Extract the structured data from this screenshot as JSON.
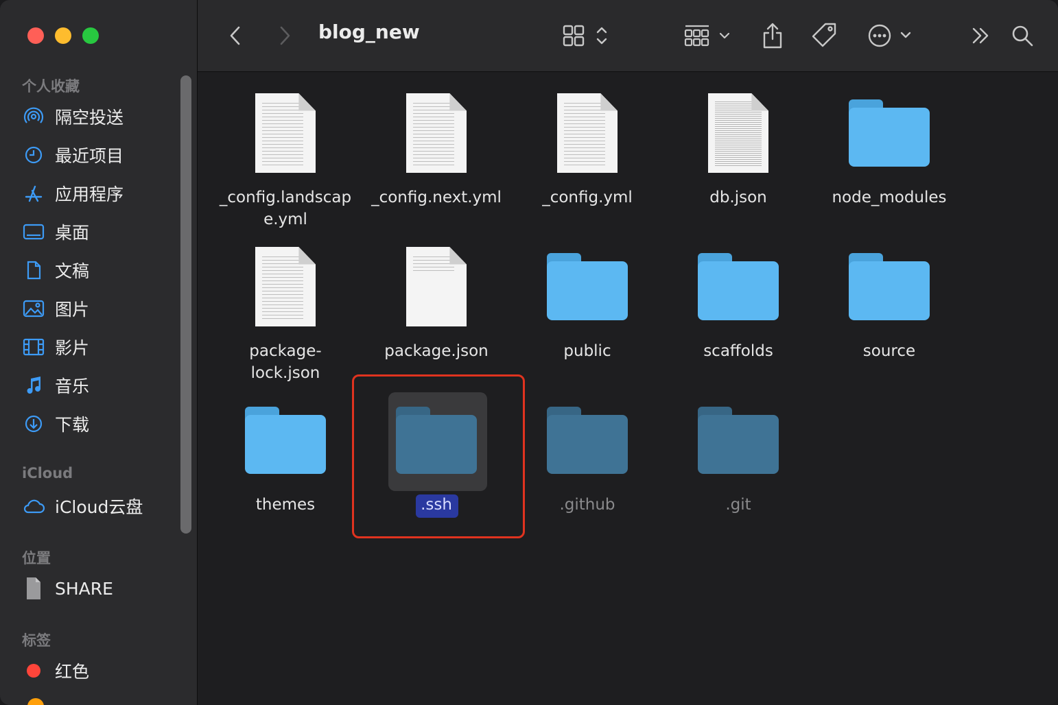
{
  "window": {
    "title": "blog_new"
  },
  "sidebar": {
    "sections": [
      {
        "label": "个人收藏",
        "items": [
          {
            "label": "隔空投送",
            "icon": "airdrop-icon"
          },
          {
            "label": "最近项目",
            "icon": "clock-icon"
          },
          {
            "label": "应用程序",
            "icon": "apps-icon"
          },
          {
            "label": "桌面",
            "icon": "desktop-icon"
          },
          {
            "label": "文稿",
            "icon": "document-icon"
          },
          {
            "label": "图片",
            "icon": "photo-icon"
          },
          {
            "label": "影片",
            "icon": "film-icon"
          },
          {
            "label": "音乐",
            "icon": "music-icon"
          },
          {
            "label": "下载",
            "icon": "download-icon"
          }
        ]
      },
      {
        "label": "iCloud",
        "items": [
          {
            "label": "iCloud云盘",
            "icon": "cloud-icon"
          }
        ]
      },
      {
        "label": "位置",
        "items": [
          {
            "label": "SHARE",
            "icon": "share-drive-icon"
          }
        ]
      },
      {
        "label": "标签",
        "items": [
          {
            "label": "红色",
            "icon": "tag-dot-icon",
            "color": "#ff453a"
          }
        ]
      }
    ]
  },
  "files": [
    {
      "name": "_config.landscape.yml",
      "line1": "_config.landscap",
      "line2": "e.yml",
      "kind": "doc"
    },
    {
      "name": "_config.next.yml",
      "line1": "_config.next.yml",
      "line2": "",
      "kind": "doc"
    },
    {
      "name": "_config.yml",
      "line1": "_config.yml",
      "line2": "",
      "kind": "doc"
    },
    {
      "name": "db.json",
      "line1": "db.json",
      "line2": "",
      "kind": "doc-dense"
    },
    {
      "name": "node_modules",
      "line1": "node_modules",
      "line2": "",
      "kind": "folder"
    },
    {
      "name": "package-lock.json",
      "line1": "package-",
      "line2": "lock.json",
      "kind": "doc"
    },
    {
      "name": "package.json",
      "line1": "package.json",
      "line2": "",
      "kind": "doc-sparse"
    },
    {
      "name": "public",
      "line1": "public",
      "line2": "",
      "kind": "folder"
    },
    {
      "name": "scaffolds",
      "line1": "scaffolds",
      "line2": "",
      "kind": "folder"
    },
    {
      "name": "source",
      "line1": "source",
      "line2": "",
      "kind": "folder"
    },
    {
      "name": "themes",
      "line1": "themes",
      "line2": "",
      "kind": "folder"
    },
    {
      "name": ".ssh",
      "line1": ".ssh",
      "line2": "",
      "kind": "folder-hidden",
      "selected": true
    },
    {
      "name": ".github",
      "line1": ".github",
      "line2": "",
      "kind": "folder-hidden"
    },
    {
      "name": ".git",
      "line1": ".git",
      "line2": "",
      "kind": "folder-hidden"
    }
  ],
  "colors": {
    "folder": "#5cb8f2",
    "folder_tab": "#4aa3dc",
    "folder_hidden": "#3f7395",
    "folder_hidden_tab": "#376685",
    "accent_highlight": "#e0331f",
    "selection_label": "#2a39a0",
    "traffic_red": "#ff5f57",
    "traffic_yellow": "#febc2e",
    "traffic_green": "#28c840",
    "sidebar_icon": "#3d9bf6"
  },
  "toolbar": {
    "icons": [
      "back-icon",
      "forward-icon",
      "grid-view-icon",
      "group-icon",
      "share-icon",
      "tag-icon",
      "more-icon",
      "expand-icon",
      "search-icon"
    ]
  }
}
